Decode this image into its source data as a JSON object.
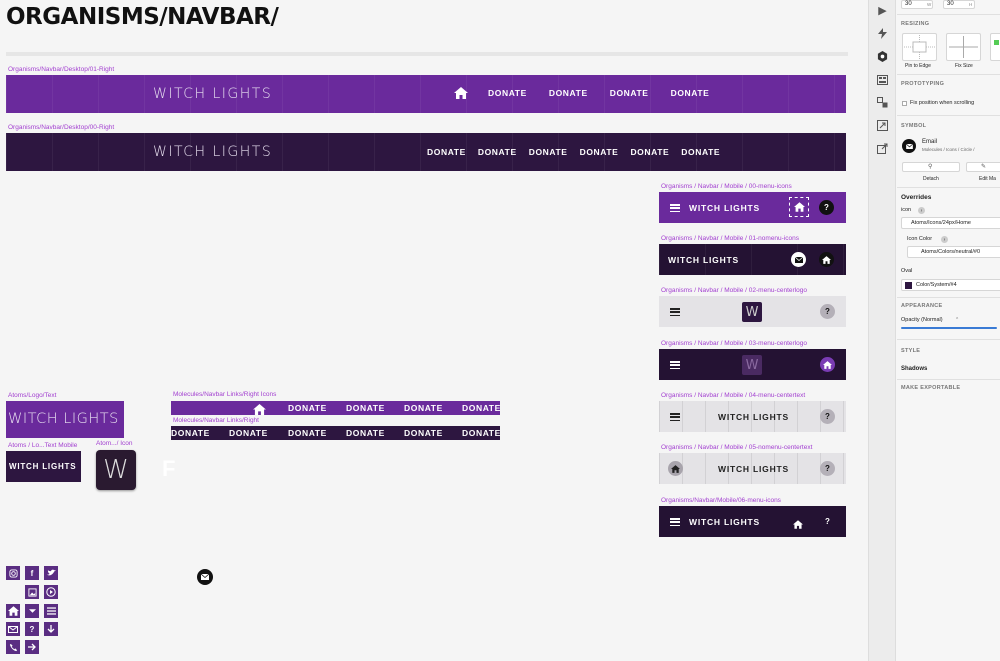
{
  "page": {
    "title": "ORGANISMS/NAVBAR/"
  },
  "brand": {
    "name": "WITCH LIGHTS",
    "logo_letter": "W"
  },
  "artboards": {
    "desktop_01_right": {
      "label": "Organisms/Navbar/Desktop/01-Right",
      "links": [
        "DONATE",
        "DONATE",
        "DONATE",
        "DONATE"
      ],
      "home_icon": "home-icon"
    },
    "desktop_00_right": {
      "label": "Organisms/Navbar/Desktop/00-Right",
      "links": [
        "DONATE",
        "DONATE",
        "DONATE",
        "DONATE",
        "DONATE",
        "DONATE"
      ]
    },
    "mobile_00": {
      "label": "Organisms / Navbar / Mobile / 00-menu-icons",
      "help": "?"
    },
    "mobile_01": {
      "label": "Organisms / Navbar / Mobile / 01-nomenu-icons"
    },
    "mobile_02": {
      "label": "Organisms / Navbar / Mobile / 02-menu-centerlogo",
      "help": "?"
    },
    "mobile_03": {
      "label": "Organisms / Navbar / Mobile / 03-menu-centerlogo"
    },
    "mobile_04": {
      "label": "Organisms / Navbar / Mobile / 04-menu-centertext",
      "help": "?"
    },
    "mobile_05": {
      "label": "Organisms / Navbar / Mobile / 05-nomenu-centertext",
      "help": "?"
    },
    "mobile_06": {
      "label": "Organisms/Navbar/Mobile/06-menu-icons",
      "help": "?"
    },
    "atoms_logo_text": {
      "label": "Atoms/Logo/Text"
    },
    "atoms_logo_text_mobile": {
      "label": "Atoms / Lo...Text Mobile"
    },
    "atoms_icon": {
      "label": "Atom.../ Icon"
    },
    "molecules_right_icons": {
      "label": "Molecules/Navbar Links/Right Icons",
      "links": [
        "DONATE",
        "DONATE",
        "DONATE",
        "DONATE"
      ]
    },
    "molecules_right": {
      "label": "Molecules/Navbar Links/Right",
      "links": [
        "DONATE",
        "DONATE",
        "DONATE",
        "DONATE",
        "DONATE",
        "DONATE"
      ]
    },
    "stray_glyph": "F"
  },
  "icon_grid": [
    "instagram-icon",
    "facebook-icon",
    "twitter-icon",
    "image-icon",
    "play-icon",
    "home-icon",
    "caret-down-icon",
    "menu-icon",
    "mail-icon",
    "help-icon",
    "download-icon",
    "phone-icon",
    "arrow-right-icon"
  ],
  "inspector": {
    "size": {
      "w_value": "30",
      "w_label": "W",
      "h_value": "30",
      "h_label": "H"
    },
    "resizing": {
      "title": "RESIZING",
      "pin_label": "Pin to Edge",
      "fix_label": "Fix Size"
    },
    "prototyping": {
      "title": "PROTOTYPING",
      "fix_position": "Fix position when scrolling"
    },
    "symbol": {
      "title": "SYMBOL",
      "name": "Email",
      "path": "Molecules / Icons / Circle /",
      "detach": "Detach",
      "edit": "Edit Ma"
    },
    "overrides": {
      "title": "Overrides",
      "icon_label": "icon",
      "icon_value": "Atoms/Icons/24px/Home",
      "color_label": "Icon Color",
      "color_value": "Atoms/Colors/neutral/#0",
      "oval_label": "Oval",
      "oval_value": "Color/System/#4"
    },
    "appearance": {
      "title": "APPEARANCE",
      "opacity": "Opacity (Normal)"
    },
    "style_title": "STYLE",
    "shadows": "Shadows",
    "export_title": "MAKE EXPORTABLE"
  },
  "colors": {
    "purple": "#6a2a9c",
    "dark": "#2d1640",
    "accent_label": "#a23fd0"
  }
}
